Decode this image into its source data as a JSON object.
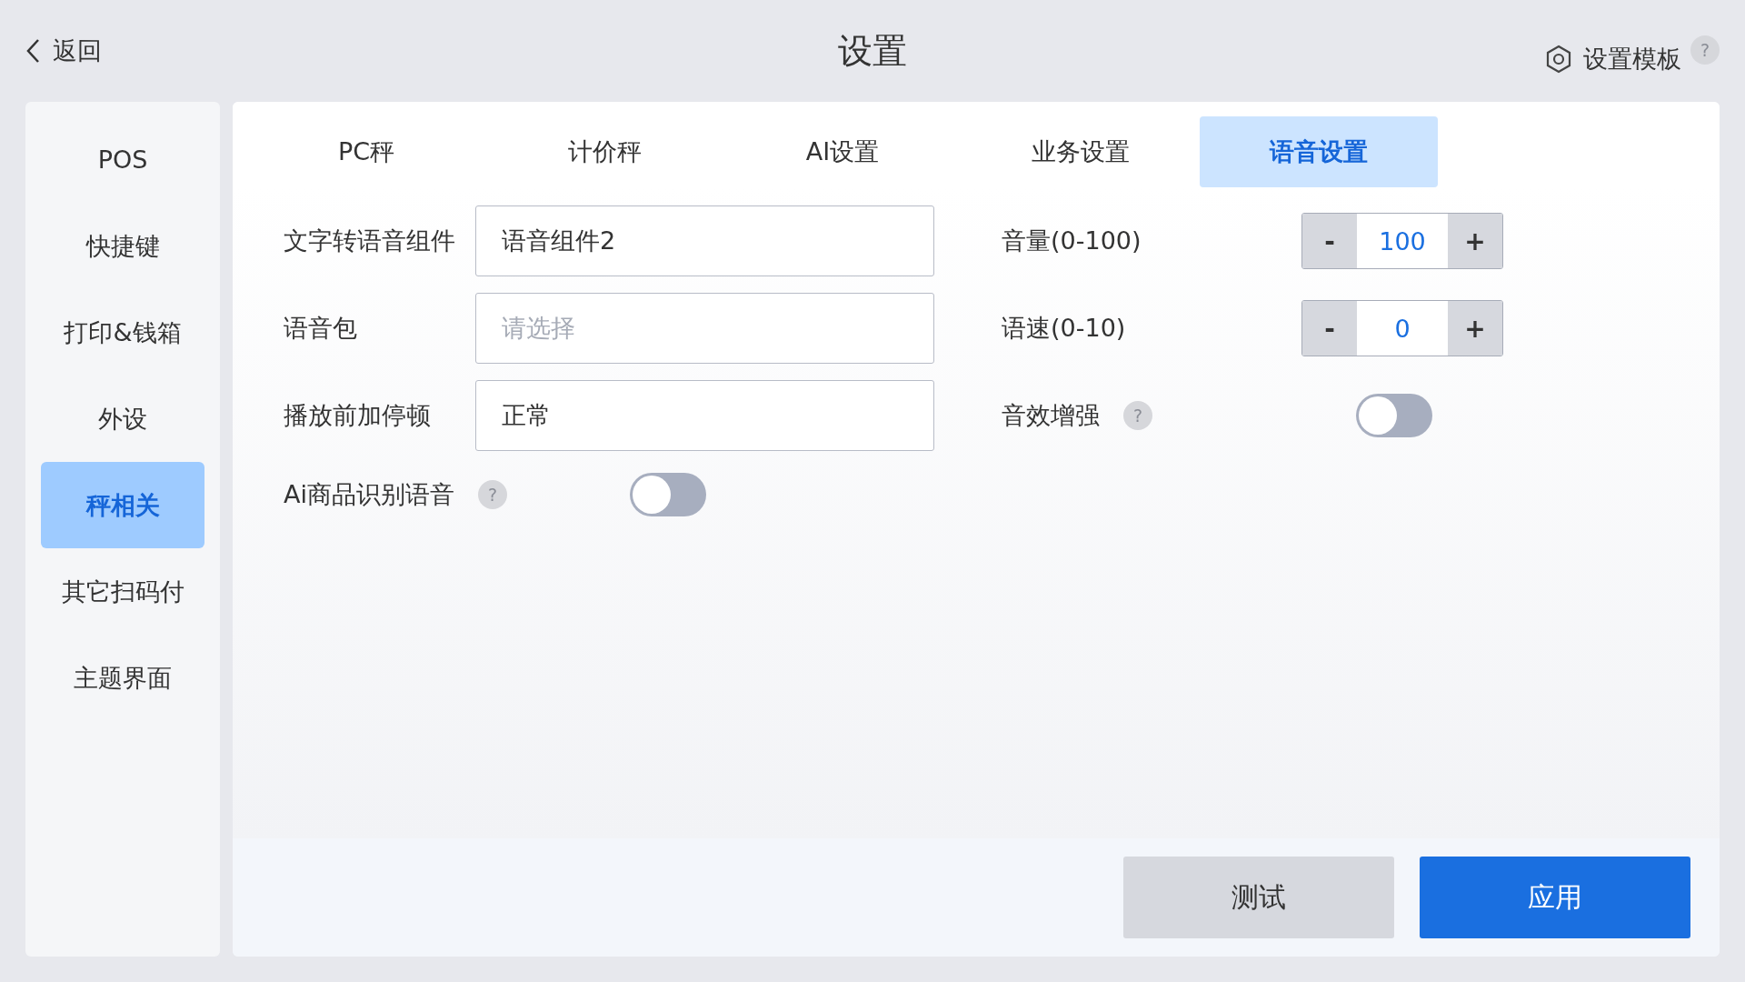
{
  "header": {
    "back_label": "返回",
    "title": "设置",
    "template_label": "设置模板",
    "help": "?"
  },
  "sidebar": {
    "items": [
      {
        "label": "POS",
        "selected": false
      },
      {
        "label": "快捷键",
        "selected": false
      },
      {
        "label": "打印&钱箱",
        "selected": false
      },
      {
        "label": "外设",
        "selected": false
      },
      {
        "label": "秤相关",
        "selected": true
      },
      {
        "label": "其它扫码付",
        "selected": false
      },
      {
        "label": "主题界面",
        "selected": false
      }
    ]
  },
  "tabs": [
    {
      "label": "PC秤",
      "selected": false
    },
    {
      "label": "计价秤",
      "selected": false
    },
    {
      "label": "AI设置",
      "selected": false
    },
    {
      "label": "业务设置",
      "selected": false
    },
    {
      "label": "语音设置",
      "selected": true
    }
  ],
  "left_rows": [
    {
      "kind": "field",
      "label": "文字转语音组件",
      "value": "语音组件2"
    },
    {
      "kind": "field",
      "label": "语音包",
      "placeholder": "请选择"
    },
    {
      "kind": "field",
      "label": "播放前加停顿",
      "value": "正常"
    },
    {
      "kind": "toggle",
      "label": "Ai商品识别语音",
      "help": "?",
      "on": false
    }
  ],
  "right_rows": [
    {
      "kind": "stepper",
      "label": "音量(0-100)",
      "minus": "-",
      "value": "100",
      "plus": "+"
    },
    {
      "kind": "stepper",
      "label": "语速(0-10)",
      "minus": "-",
      "value": "0",
      "plus": "+"
    },
    {
      "kind": "toggle",
      "label": "音效增强",
      "help": "?",
      "on": false
    }
  ],
  "buttons": [
    {
      "kind": "secondary",
      "label": "测试"
    },
    {
      "kind": "primary",
      "label": "应用"
    }
  ]
}
